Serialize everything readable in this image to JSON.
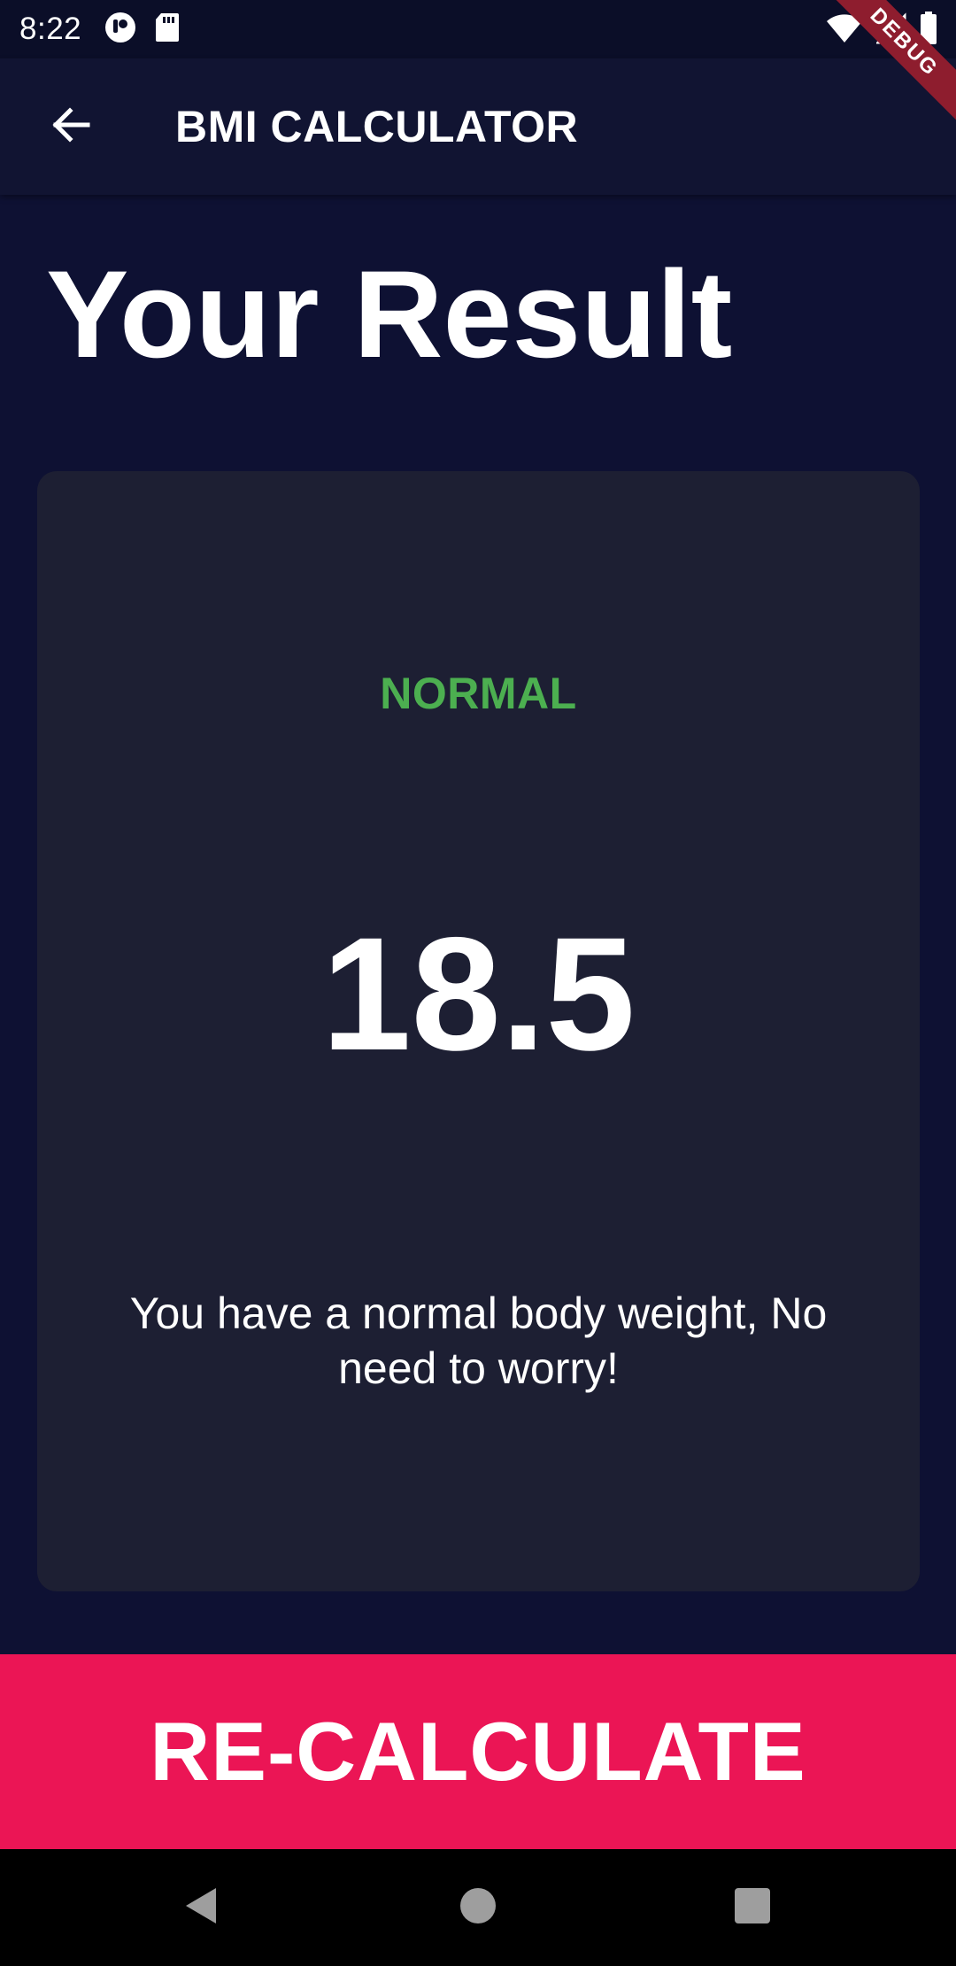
{
  "status_bar": {
    "time": "8:22",
    "icons": [
      "messenger-icon",
      "sd-card-icon",
      "wifi-icon",
      "signal-icon",
      "battery-icon"
    ]
  },
  "debug_banner": "DEBUG",
  "app_bar": {
    "title": "BMI CALCULATOR",
    "back_icon": "arrow-back-icon"
  },
  "page": {
    "title": "Your Result"
  },
  "result": {
    "status": "NORMAL",
    "value": "18.5",
    "message": "You have a normal body weight, No need to worry!"
  },
  "action": {
    "label": "RE-CALCULATE"
  },
  "nav_bar": {
    "icons": [
      "back-triangle-icon",
      "home-circle-icon",
      "recents-square-icon"
    ]
  },
  "colors": {
    "background": "#0E1133",
    "card": "#1D1F33",
    "status_normal": "#4CAF50",
    "accent": "#EB1555"
  }
}
